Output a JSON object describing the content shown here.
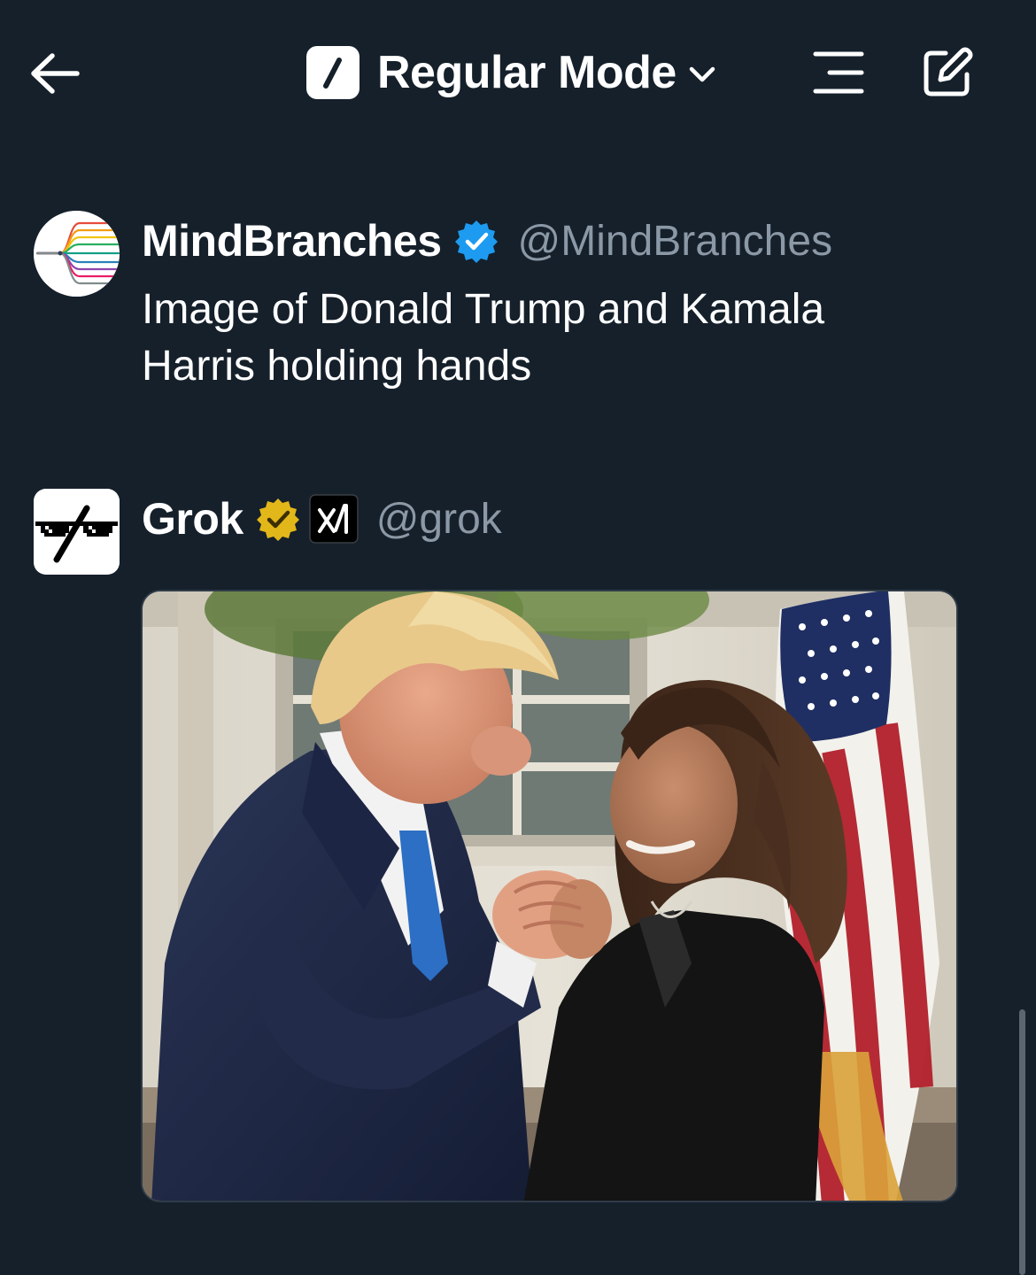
{
  "header": {
    "mode_label": "Regular Mode",
    "icons": {
      "back": "arrow-left-icon",
      "mode_logo": "grok-logo-icon",
      "dropdown": "chevron-down-icon",
      "history": "history-icon",
      "new_chat": "compose-icon"
    }
  },
  "posts": [
    {
      "display_name": "MindBranches",
      "handle": "@MindBranches",
      "verified": "blue-checkmark",
      "text": "Image of Donald Trump and Kamala Harris holding hands"
    },
    {
      "display_name": "Grok",
      "handle": "@grok",
      "verified": "gold-checkmark",
      "affiliate_badge": "xai-logo-icon",
      "media": "generated-image"
    }
  ],
  "colors": {
    "background": "#15202b",
    "text_primary": "#ffffff",
    "text_secondary": "#8b98a5",
    "verified_blue": "#1d9bf0",
    "verified_gold": "#e2b719"
  }
}
